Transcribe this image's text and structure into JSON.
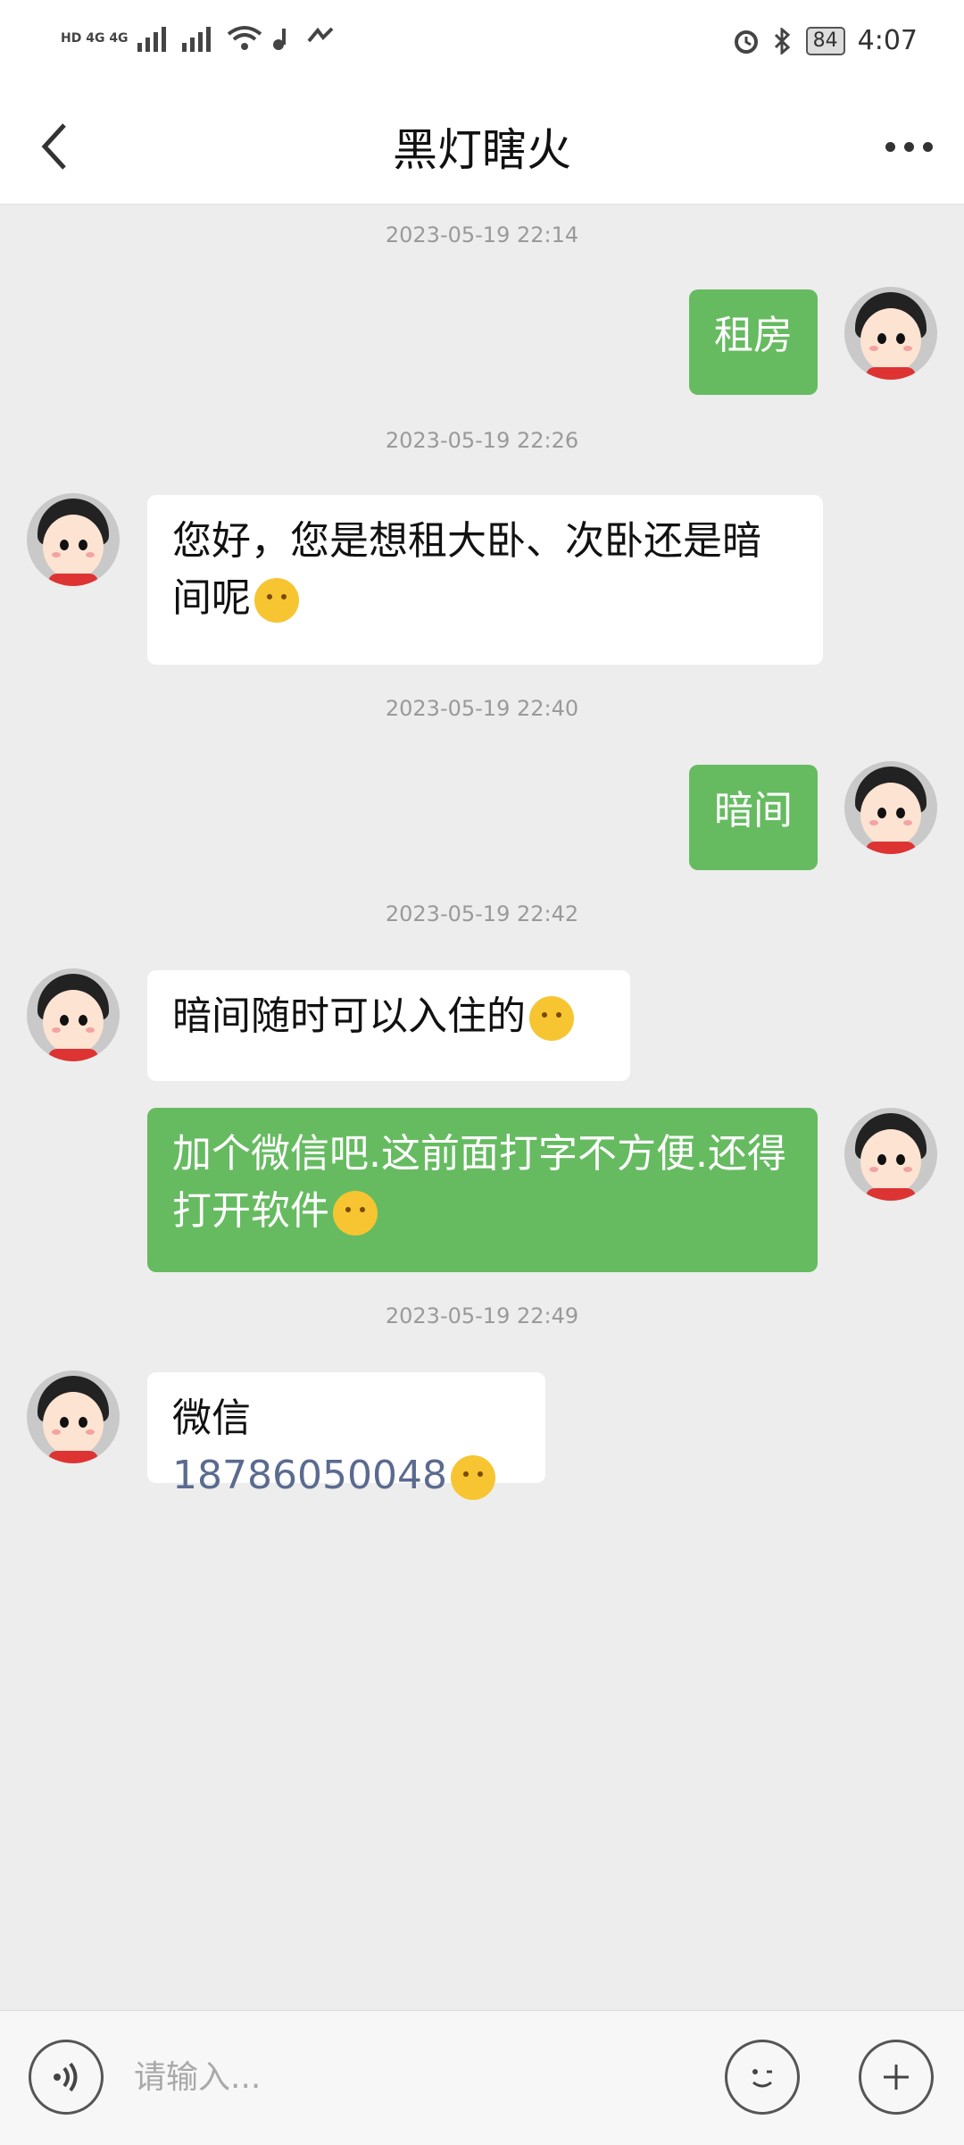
{
  "status_bar": {
    "left_text": "HD 4G 4G",
    "battery": "84",
    "time": "4:07"
  },
  "header": {
    "back_icon": "chevron-left-icon",
    "title": "黑灯瞎火",
    "more_icon": "more-horizontal-icon"
  },
  "messages": [
    {
      "timestamp": "2023-05-19 22:14",
      "direction": "out",
      "text": "租房"
    },
    {
      "timestamp": "2023-05-19 22:26",
      "direction": "in",
      "text": "您好，您是想租大卧、次卧还是暗间呢"
    },
    {
      "timestamp": "2023-05-19 22:40",
      "direction": "out",
      "text": "暗间"
    },
    {
      "timestamp": "2023-05-19 22:42",
      "direction": "in",
      "text": "暗间随时可以入住的"
    },
    {
      "timestamp": "",
      "direction": "out",
      "text": "加个微信吧.这前面打字不方便.还得打开软件"
    },
    {
      "timestamp": "2023-05-19 22:49",
      "direction": "in",
      "text_prefix": "微信",
      "phone": "18786050048"
    }
  ],
  "input": {
    "placeholder": "请输入...",
    "voice_icon": "voice-icon",
    "emoji_icon": "emoji-icon",
    "plus_icon": "plus-icon"
  },
  "colors": {
    "outgoing_bubble": "#66bb61",
    "incoming_bubble": "#ffffff",
    "background": "#ededed"
  }
}
